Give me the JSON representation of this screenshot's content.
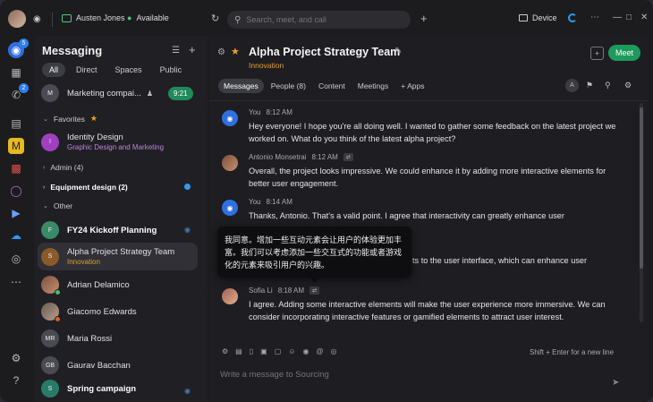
{
  "titlebar": {
    "user_name": "Austen Jones",
    "status": "Available",
    "search_placeholder": "Search, meet, and call",
    "device_label": "Device"
  },
  "rail": {
    "badges": {
      "messaging": "5",
      "calls": "2"
    }
  },
  "sidebar": {
    "title": "Messaging",
    "filters": [
      "All",
      "Direct",
      "Spaces",
      "Public"
    ],
    "pinned": {
      "name": "Marketing compai...",
      "time": "9:21",
      "initial": "M"
    },
    "favorites_label": "Favorites",
    "favorites": [
      {
        "name": "Identity Design",
        "sub": "Graphic Design and Marketing",
        "initial": "I"
      }
    ],
    "admin_label": "Admin (4)",
    "equipment_label": "Equipment design (2)",
    "other_label": "Other",
    "other": [
      {
        "name": "FY24 Kickoff Planning",
        "initial": "F"
      },
      {
        "name": "Alpha Project Strategy Team",
        "sub": "Innovation",
        "initial": "S"
      },
      {
        "name": "Adrian Delamico",
        "initial": ""
      },
      {
        "name": "Giacomo Edwards",
        "initial": ""
      },
      {
        "name": "Maria Rossi",
        "initial": "MR"
      },
      {
        "name": "Gaurav Bacchan",
        "initial": "GB"
      },
      {
        "name": "Spring campaign",
        "initial": "S"
      }
    ]
  },
  "main": {
    "title": "Alpha Project Strategy Team",
    "subtitle": "Innovation",
    "meet_label": "Meet",
    "tabs": [
      "Messages",
      "People (8)",
      "Content",
      "Meetings",
      "Apps"
    ],
    "messages": [
      {
        "author": "You",
        "time": "8:12 AM",
        "text": "Hey everyone! I hope you're all doing well. I wanted to gather some feedback on the latest project we worked on. What do you think of the latest alpha project?"
      },
      {
        "author": "Antonio Monsetrai",
        "time": "8:12 AM",
        "text": "Overall, the project looks impressive. We could enhance it by adding more interactive elements for better user engagement."
      },
      {
        "author": "You",
        "time": "8:14 AM",
        "text": "Thanks, Antonio. That's a valid point. I agree that interactivity can greatly enhance user"
      },
      {
        "author": "",
        "time": "",
        "text": "ts to the user interface, which can enhance user"
      },
      {
        "author": "Sofia Li",
        "time": "8:18 AM",
        "text": "I agree. Adding some interactive elements will make the user experience more immersive. We can consider incorporating interactive features or gamified elements to attract user interest."
      }
    ],
    "tooltip": "我同意。增加一些互动元素会让用户的体验更加丰富。我们可以考虑添加一些交互式的功能或者游戏化的元素来吸引用户的兴趣。",
    "composer_hint": "Shift + Enter for a new line",
    "composer_placeholder": "Write a message to Sourcing"
  },
  "colors": {
    "accent": "#2f6fe0",
    "meet": "#1f9a5f",
    "favorite_star": "#f0a020",
    "subtitle": "#e0a030"
  }
}
